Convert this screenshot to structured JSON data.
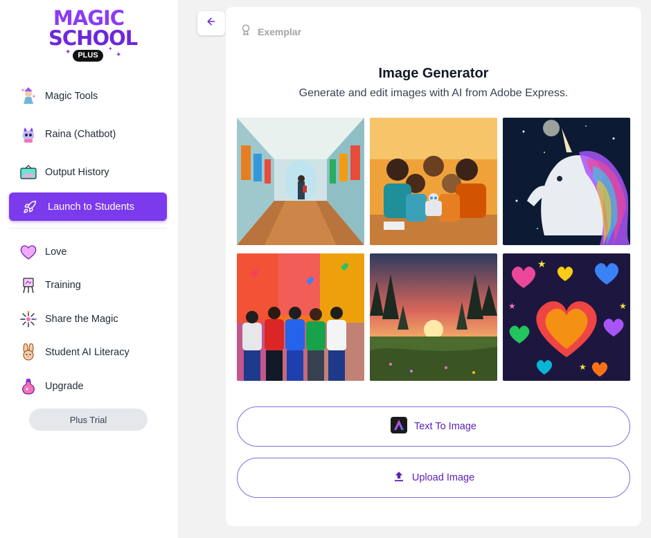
{
  "brand": {
    "line1": "MAGIC",
    "line2": "SCHOOL",
    "badge": "PLUS"
  },
  "sidebar": {
    "items": [
      {
        "label": "Magic Tools",
        "icon": "magic-tools-icon"
      },
      {
        "label": "Raina (Chatbot)",
        "icon": "raina-chatbot-icon"
      },
      {
        "label": "Output History",
        "icon": "output-history-icon"
      },
      {
        "label": "Launch to Students",
        "icon": "rocket-icon"
      }
    ],
    "secondary": [
      {
        "label": "Love",
        "icon": "heart-icon"
      },
      {
        "label": "Training",
        "icon": "easel-icon"
      },
      {
        "label": "Share the Magic",
        "icon": "sparkle-icon"
      },
      {
        "label": "Student AI Literacy",
        "icon": "bunny-icon"
      },
      {
        "label": "Upgrade",
        "icon": "potion-icon"
      }
    ],
    "trial_label": "Plus Trial"
  },
  "main": {
    "exemplar_label": "Exemplar",
    "title": "Image Generator",
    "subtitle": "Generate and edit images with AI from Adobe Express.",
    "buttons": {
      "text_to_image": "Text To Image",
      "upload_image": "Upload Image"
    }
  },
  "colors": {
    "accent": "#7c3aed",
    "button_text": "#5b21b6",
    "button_border": "#7c6fdc"
  }
}
